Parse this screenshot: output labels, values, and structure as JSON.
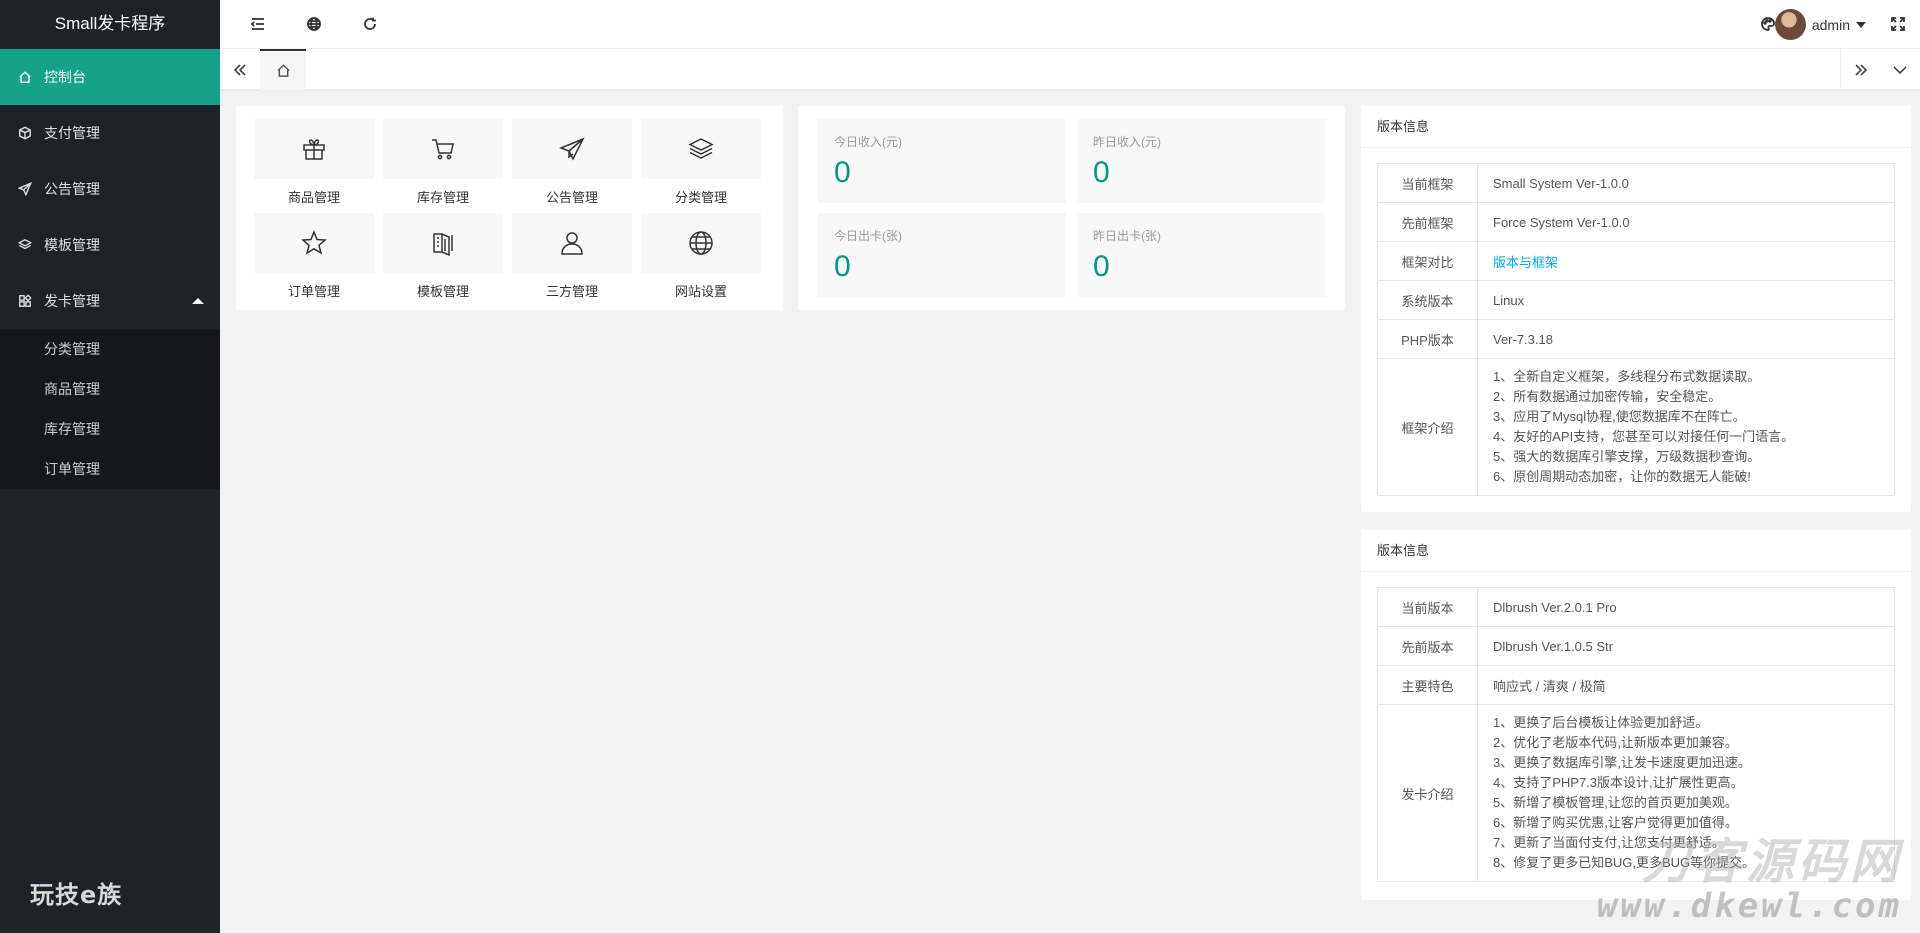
{
  "app": {
    "title": "Small发卡程序",
    "brand_bottom": "玩技e族"
  },
  "sidebar": {
    "items": [
      {
        "label": "控制台",
        "icon": "home-icon"
      },
      {
        "label": "支付管理",
        "icon": "cube-icon"
      },
      {
        "label": "公告管理",
        "icon": "send-icon"
      },
      {
        "label": "模板管理",
        "icon": "layers-icon"
      },
      {
        "label": "发卡管理",
        "icon": "apps-icon"
      }
    ],
    "sub_items": [
      "分类管理",
      "商品管理",
      "库存管理",
      "订单管理"
    ]
  },
  "header": {
    "user": "admin"
  },
  "shortcuts": [
    {
      "label": "商品管理",
      "icon": "gift-icon"
    },
    {
      "label": "库存管理",
      "icon": "cart-icon"
    },
    {
      "label": "公告管理",
      "icon": "send-icon"
    },
    {
      "label": "分类管理",
      "icon": "layers-icon"
    },
    {
      "label": "订单管理",
      "icon": "star-icon"
    },
    {
      "label": "模板管理",
      "icon": "template-icon"
    },
    {
      "label": "三方管理",
      "icon": "user-icon"
    },
    {
      "label": "网站设置",
      "icon": "globe-icon"
    }
  ],
  "stats": [
    {
      "title": "今日收入(元)",
      "value": "0"
    },
    {
      "title": "昨日收入(元)",
      "value": "0"
    },
    {
      "title": "今日出卡(张)",
      "value": "0"
    },
    {
      "title": "昨日出卡(张)",
      "value": "0"
    }
  ],
  "panel1": {
    "title": "版本信息",
    "rows": [
      {
        "k": "当前框架",
        "v": "Small System Ver-1.0.0"
      },
      {
        "k": "先前框架",
        "v": "Force System Ver-1.0.0"
      },
      {
        "k": "框架对比",
        "v": "版本与框架"
      },
      {
        "k": "系统版本",
        "v": "Linux"
      },
      {
        "k": "PHP版本",
        "v": "Ver-7.3.18"
      }
    ],
    "intro_key": "框架介绍",
    "intro": [
      "1、全新自定义框架，多线程分布式数据读取。",
      "2、所有数据通过加密传输，安全稳定。",
      "3、应用了Mysql协程,使您数据库不在阵亡。",
      "4、友好的API支持，您甚至可以对接任何一门语言。",
      "5、强大的数据库引擎支撑，万级数据秒查询。",
      "6、原创周期动态加密，让你的数据无人能破!"
    ]
  },
  "panel2": {
    "title": "版本信息",
    "rows": [
      {
        "k": "当前版本",
        "v": "Dlbrush Ver.2.0.1 Pro"
      },
      {
        "k": "先前版本",
        "v": "Dlbrush Ver.1.0.5 Str"
      },
      {
        "k": "主要特色",
        "v": "响应式 / 清爽 / 极简"
      }
    ],
    "intro_key": "发卡介绍",
    "intro": [
      "1、更换了后台模板让体验更加舒适。",
      "2、优化了老版本代码,让新版本更加兼容。",
      "3、更换了数据库引擎,让发卡速度更加迅速。",
      "4、支持了PHP7.3版本设计,让扩展性更高。",
      "5、新增了模板管理,让您的首页更加美观。",
      "6、新增了购买优惠,让客户觉得更加值得。",
      "7、更新了当面付支付,让您支付更舒适。",
      "8、修复了更多已知BUG,更多BUG等你提交。"
    ]
  },
  "watermark": {
    "line1": "刀客源码网",
    "line2": "www.dkewl.com"
  },
  "colors": {
    "accent": "#16a18a",
    "sidebar_bg": "#20222a",
    "stat_value": "#009688",
    "link": "#01aaed"
  }
}
